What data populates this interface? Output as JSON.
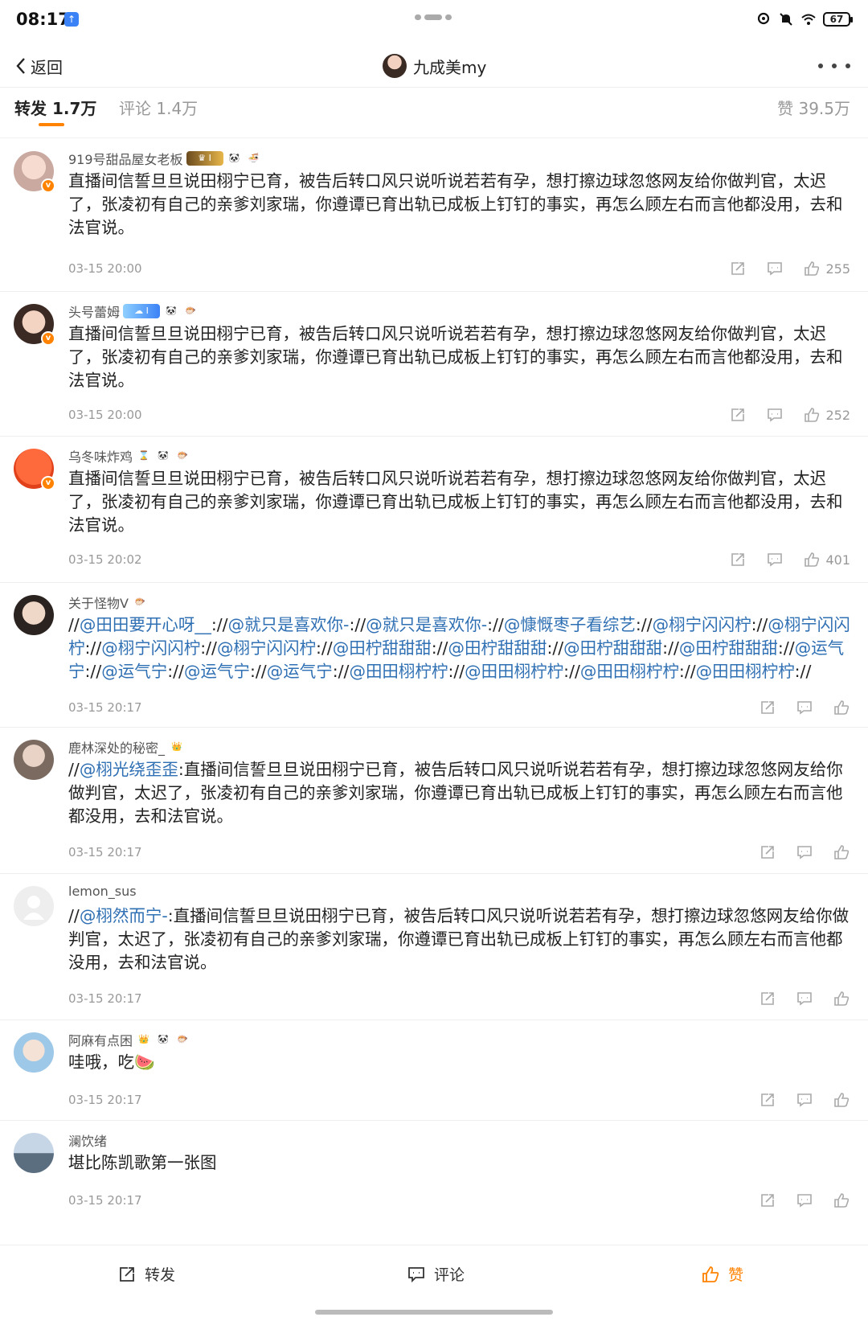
{
  "status_bar": {
    "time": "08:17",
    "battery": "67",
    "icons": [
      "app-notification-icon",
      "location-icon",
      "mute-icon",
      "wifi-icon",
      "battery-icon"
    ]
  },
  "nav": {
    "back_label": "返回",
    "username": "九成美my",
    "more_icon": "more-dots-icon"
  },
  "tabs": {
    "reposts_label": "转发",
    "reposts_count": "1.7万",
    "comments_label": "评论",
    "comments_count": "1.4万",
    "likes_label": "赞",
    "likes_count": "39.5万"
  },
  "comments": [
    {
      "name": "919号甜品屋女老板",
      "segments": [
        {
          "text": "直播间信誓旦旦说田栩宁已育，被告后转口风只说听说若若有孕，想打擦边球忽悠网友给你做判官，太迟了，张凌初有自己的亲爹刘家瑞，你遵谭已育出轨已成板上钉钉的事实，再怎么顾左右而言他都没用，去和法官说。"
        }
      ],
      "time": "03-15 20:00",
      "likes": "255"
    },
    {
      "name": "头号蕾姆",
      "segments": [
        {
          "text": "直播间信誓旦旦说田栩宁已育，被告后转口风只说听说若若有孕，想打擦边球忽悠网友给你做判官，太迟了，张凌初有自己的亲爹刘家瑞，你遵谭已育出轨已成板上钉钉的事实，再怎么顾左右而言他都没用，去和法官说。"
        }
      ],
      "time": "03-15 20:00",
      "likes": "252"
    },
    {
      "name": "乌冬味炸鸡",
      "segments": [
        {
          "text": "直播间信誓旦旦说田栩宁已育，被告后转口风只说听说若若有孕，想打擦边球忽悠网友给你做判官，太迟了，张凌初有自己的亲爹刘家瑞，你遵谭已育出轨已成板上钉钉的事实，再怎么顾左右而言他都没用，去和法官说。"
        }
      ],
      "time": "03-15 20:02",
      "likes": "401"
    },
    {
      "name": "关于怪物V",
      "segments": [
        {
          "text": "//"
        },
        {
          "text": "@田田要开心呀__",
          "mention": true
        },
        {
          "text": "://"
        },
        {
          "text": "@就只是喜欢你-",
          "mention": true
        },
        {
          "text": "://"
        },
        {
          "text": "@就只是喜欢你-",
          "mention": true
        },
        {
          "text": "://"
        },
        {
          "text": "@慷慨枣子看综艺",
          "mention": true
        },
        {
          "text": "://"
        },
        {
          "text": "@栩宁闪闪柠",
          "mention": true
        },
        {
          "text": "://"
        },
        {
          "text": "@栩宁闪闪柠",
          "mention": true
        },
        {
          "text": "://"
        },
        {
          "text": "@栩宁闪闪柠",
          "mention": true
        },
        {
          "text": "://"
        },
        {
          "text": "@栩宁闪闪柠",
          "mention": true
        },
        {
          "text": "://"
        },
        {
          "text": "@田柠甜甜甜",
          "mention": true
        },
        {
          "text": "://"
        },
        {
          "text": "@田柠甜甜甜",
          "mention": true
        },
        {
          "text": "://"
        },
        {
          "text": "@田柠甜甜甜",
          "mention": true
        },
        {
          "text": "://"
        },
        {
          "text": "@田柠甜甜甜",
          "mention": true
        },
        {
          "text": "://"
        },
        {
          "text": "@运气宁",
          "mention": true
        },
        {
          "text": "://"
        },
        {
          "text": "@运气宁",
          "mention": true
        },
        {
          "text": "://"
        },
        {
          "text": "@运气宁",
          "mention": true
        },
        {
          "text": "://"
        },
        {
          "text": "@运气宁",
          "mention": true
        },
        {
          "text": "://"
        },
        {
          "text": "@田田栩柠柠",
          "mention": true
        },
        {
          "text": "://"
        },
        {
          "text": "@田田栩柠柠",
          "mention": true
        },
        {
          "text": "://"
        },
        {
          "text": "@田田栩柠柠",
          "mention": true
        },
        {
          "text": "://"
        },
        {
          "text": "@田田栩柠柠",
          "mention": true
        },
        {
          "text": "://"
        }
      ],
      "time": "03-15 20:17",
      "likes": ""
    },
    {
      "name": "鹿林深处的秘密_",
      "segments": [
        {
          "text": "//"
        },
        {
          "text": "@栩光绕歪歪",
          "mention": true
        },
        {
          "text": ":直播间信誓旦旦说田栩宁已育，被告后转口风只说听说若若有孕，想打擦边球忽悠网友给你做判官，太迟了，张凌初有自己的亲爹刘家瑞，你遵谭已育出轨已成板上钉钉的事实，再怎么顾左右而言他都没用，去和法官说。"
        }
      ],
      "time": "03-15 20:17",
      "likes": ""
    },
    {
      "name": "lemon_sus",
      "segments": [
        {
          "text": "//"
        },
        {
          "text": "@栩然而宁-",
          "mention": true
        },
        {
          "text": ":直播间信誓旦旦说田栩宁已育，被告后转口风只说听说若若有孕，想打擦边球忽悠网友给你做判官，太迟了，张凌初有自己的亲爹刘家瑞，你遵谭已育出轨已成板上钉钉的事实，再怎么顾左右而言他都没用，去和法官说。"
        }
      ],
      "time": "03-15 20:17",
      "likes": ""
    },
    {
      "name": "阿麻有点困",
      "segments": [
        {
          "text": "哇哦，吃🍉"
        }
      ],
      "time": "03-15 20:17",
      "likes": ""
    },
    {
      "name": "澜饮绪",
      "segments": [
        {
          "text": "堪比陈凯歌第一张图"
        }
      ],
      "time": "03-15 20:17",
      "likes": ""
    }
  ],
  "bottom_bar": {
    "repost_label": "转发",
    "comment_label": "评论",
    "like_label": "赞"
  },
  "colors": {
    "accent": "#ff8200",
    "mention": "#2f6fb3",
    "meta_gray": "#999999"
  }
}
